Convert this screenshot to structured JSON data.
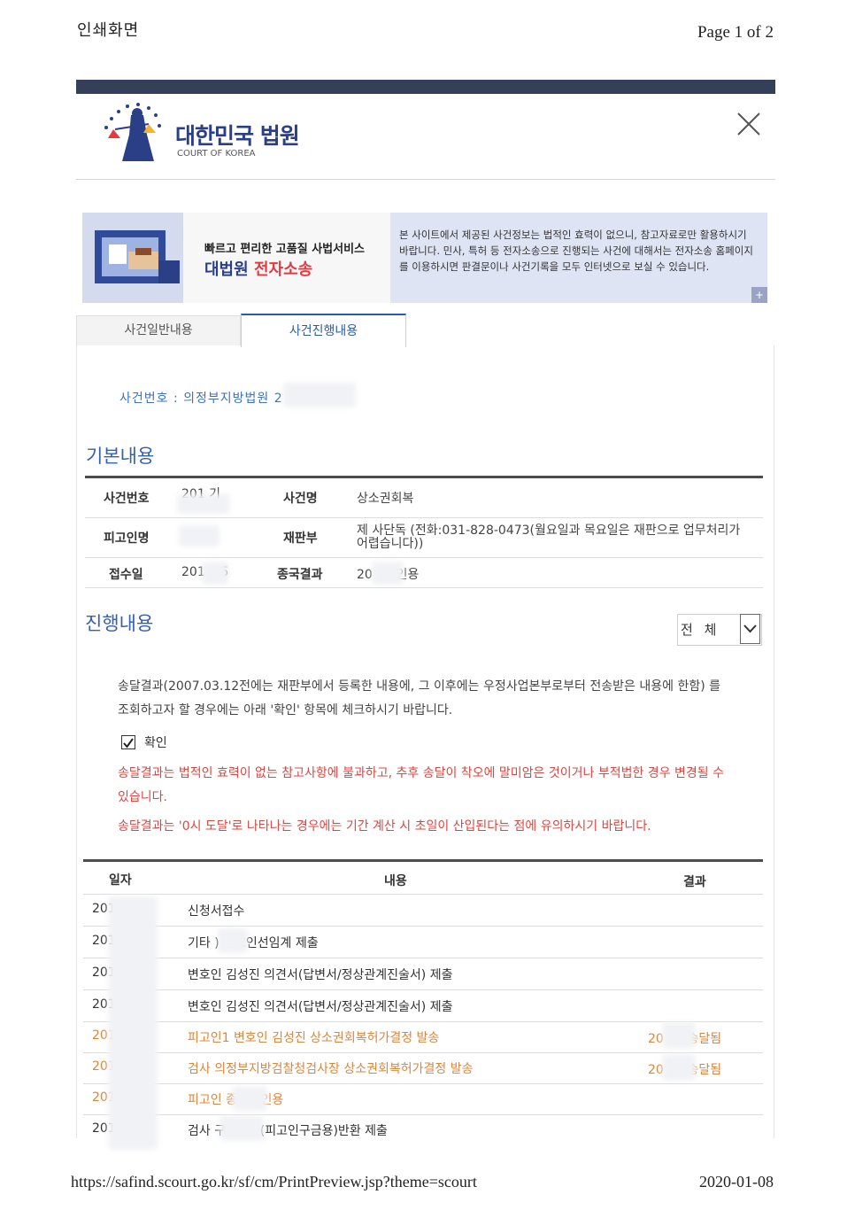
{
  "print_header": {
    "title": "인쇄화면",
    "page": "Page 1 of 2"
  },
  "logo": {
    "name_ko": "대한민국 법원",
    "name_en": "COURT OF KOREA"
  },
  "banner": {
    "line1": "빠르고 편리한 고품질 사법서비스",
    "line2_prefix": "대법원 ",
    "line2_highlight": "전자소송",
    "text": "본 사이트에서 제공된 사건정보는 법적인 효력이 없으니, 참고자료로만 활용하시기 바랍니다. 민사, 특허 등 전자소송으로 진행되는 사건에 대해서는 전자소송 홈페이지를 이용하시면 판결문이나 사건기록을 모두 인터넷으로 보실 수 있습니다.",
    "plus": "+"
  },
  "tabs": {
    "general": "사건일반내용",
    "progress": "사건진행내용"
  },
  "case_number_line": "사건번호 : 의정부지방법원 2",
  "basic": {
    "title": "기본내용",
    "rows": [
      {
        "l1": "사건번호",
        "v1": "201  기",
        "l2": "사건명",
        "v2": "상소권회복"
      },
      {
        "l1": "피고인명",
        "v1": "",
        "l2": "재판부",
        "v2": "제  사단독 (전화:031-828-0473(월요일과 목요일은 재판으로 업무처리가 어렵습니다))"
      },
      {
        "l1": "접수일",
        "v1": "201   .25",
        "l2": "종국결과",
        "v2": "20     17 인용"
      }
    ]
  },
  "progress": {
    "title": "진행내용",
    "select_value": "전 체",
    "notice": "송달결과(2007.03.12전에는 재판부에서 등록한 내용에, 그 이후에는 우정사업본부로부터 전송받은 내용에 한함) 를 조회하고자 할 경우에는 아래 '확인' 항목에 체크하시기 바랍니다.",
    "checkbox_label": "확인",
    "checked": true,
    "warning1": "송달결과는 법적인 효력이 없는 참고사항에 불과하고, 추후 송달이 착오에 말미암은 것이거나 부적법한 경우 변경될 수 있습니다.",
    "warning2": "송달결과는 '0시 도달'로 나타나는 경우에는 기간 계산 시 초일이 산입된다는 점에 유의하시기 바랍니다."
  },
  "table": {
    "headers": [
      "일자",
      "내용",
      "결과"
    ],
    "rows": [
      {
        "date": "201",
        "content": "신청서접수",
        "result": "",
        "highlight": false
      },
      {
        "date": "201",
        "content": "기타        ) 변호인선임계 제출",
        "result": "",
        "highlight": false
      },
      {
        "date": "201",
        "content": "변호인 김성진 의견서(답변서/정상관계진술서) 제출",
        "result": "",
        "highlight": false
      },
      {
        "date": "201",
        "content": "변호인 김성진 의견서(답변서/정상관계진술서) 제출",
        "result": "",
        "highlight": false
      },
      {
        "date": "201",
        "content": "피고인1 변호인 김성진 상소권회복허가결정 발송",
        "result": "20         20 송달됨",
        "highlight": true
      },
      {
        "date": "201",
        "content": "검사 의정부지방검찰청검사장 상소권회복허가결정 발송",
        "result": "20         17 송달됨",
        "highlight": true
      },
      {
        "date": "201",
        "content": "피고인          종국 : 인용",
        "result": "",
        "highlight": true
      },
      {
        "date": "201",
        "content": "검사            구속영장(피고인구금용)반환 제출",
        "result": "",
        "highlight": false
      }
    ]
  },
  "footer": {
    "url": "https://safind.scourt.go.kr/sf/cm/PrintPreview.jsp?theme=scourt",
    "date": "2020-01-08"
  },
  "colors": {
    "header_bar": "#34405a",
    "accent_blue": "#2b5aa6",
    "warning_red": "#e0443f",
    "highlight_orange": "#e0843a"
  }
}
